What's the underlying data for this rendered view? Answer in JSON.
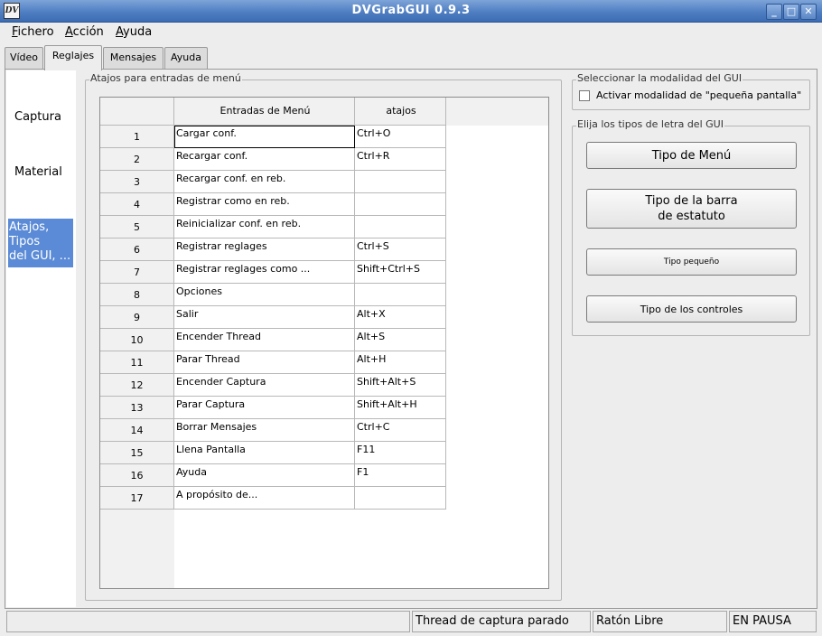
{
  "window": {
    "title": "DVGrabGUI 0.9.3",
    "icon_text": "DV",
    "minimize": "_",
    "maximize": "□",
    "close": "✕"
  },
  "menubar": {
    "items": [
      "Fichero",
      "Acción",
      "Ayuda"
    ]
  },
  "tabs": [
    {
      "label": "Vídeo",
      "active": false
    },
    {
      "label": "Reglajes",
      "active": true
    },
    {
      "label": "Mensajes",
      "active": false
    },
    {
      "label": "Ayuda",
      "active": false
    }
  ],
  "sidebar": {
    "items": [
      {
        "label": "Captura",
        "selected": false
      },
      {
        "label": "Material",
        "selected": false
      },
      {
        "label": "Atajos,\nTipos\ndel GUI, ...",
        "selected": true
      }
    ]
  },
  "shortcuts_group": {
    "title": "Atajos para entradas de menú",
    "headers": [
      "Entradas de Menú",
      "atajos"
    ],
    "rows": [
      {
        "num": "1",
        "entry": "Cargar conf.",
        "shortcut": "Ctrl+O"
      },
      {
        "num": "2",
        "entry": "Recargar conf.",
        "shortcut": "Ctrl+R"
      },
      {
        "num": "3",
        "entry": "Recargar conf. en reb.",
        "shortcut": ""
      },
      {
        "num": "4",
        "entry": "Registrar como en reb.",
        "shortcut": ""
      },
      {
        "num": "5",
        "entry": "Reinicializar conf. en reb.",
        "shortcut": ""
      },
      {
        "num": "6",
        "entry": "Registrar reglages",
        "shortcut": "Ctrl+S"
      },
      {
        "num": "7",
        "entry": "Registrar reglages como ...",
        "shortcut": "Shift+Ctrl+S"
      },
      {
        "num": "8",
        "entry": "Opciones",
        "shortcut": ""
      },
      {
        "num": "9",
        "entry": "Salir",
        "shortcut": "Alt+X"
      },
      {
        "num": "10",
        "entry": "Encender Thread",
        "shortcut": "Alt+S"
      },
      {
        "num": "11",
        "entry": "Parar Thread",
        "shortcut": "Alt+H"
      },
      {
        "num": "12",
        "entry": "Encender Captura",
        "shortcut": "Shift+Alt+S"
      },
      {
        "num": "13",
        "entry": "Parar Captura",
        "shortcut": "Shift+Alt+H"
      },
      {
        "num": "14",
        "entry": "Borrar Mensajes",
        "shortcut": "Ctrl+C"
      },
      {
        "num": "15",
        "entry": "Llena Pantalla",
        "shortcut": "F11"
      },
      {
        "num": "16",
        "entry": "Ayuda",
        "shortcut": "F1"
      },
      {
        "num": "17",
        "entry": "A propósito de...",
        "shortcut": ""
      }
    ]
  },
  "gui_mode_group": {
    "title": "Seleccionar la modalidad del GUI",
    "checkbox_label": "Activar modalidad de \"pequeña pantalla\"",
    "checked": false
  },
  "fonts_group": {
    "title": "Elija los tipos de letra del GUI",
    "buttons": [
      "Tipo de Menú",
      "Tipo de la barra\nde estatuto",
      "Tipo pequeño",
      "Tipo de los controles"
    ]
  },
  "statusbar": {
    "cells": [
      "",
      "Thread de captura parado",
      "Ratón Libre",
      "EN PAUSA"
    ]
  }
}
